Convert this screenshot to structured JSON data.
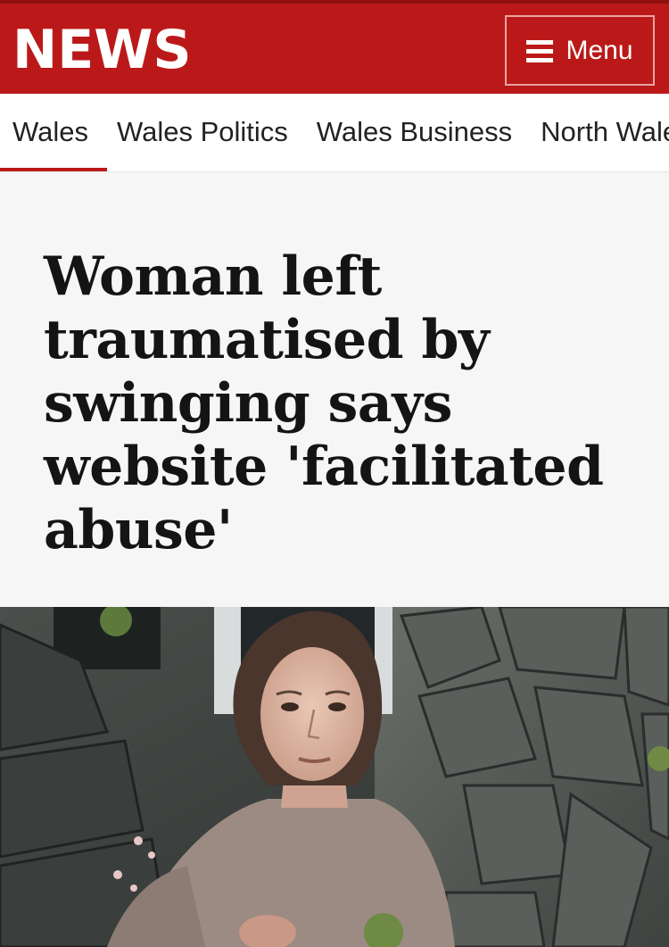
{
  "header": {
    "logo_text": "NEWS",
    "menu_label": "Menu",
    "brand_color": "#bb1919"
  },
  "subnav": {
    "items": [
      {
        "label": "Wales"
      },
      {
        "label": "Wales Politics"
      },
      {
        "label": "Wales Business"
      },
      {
        "label": "North Wales"
      }
    ],
    "active_index": 0
  },
  "article": {
    "headline": "Woman left traumatised by swinging says website 'facilitated abuse'",
    "image_description_icon": "photo-icon"
  }
}
